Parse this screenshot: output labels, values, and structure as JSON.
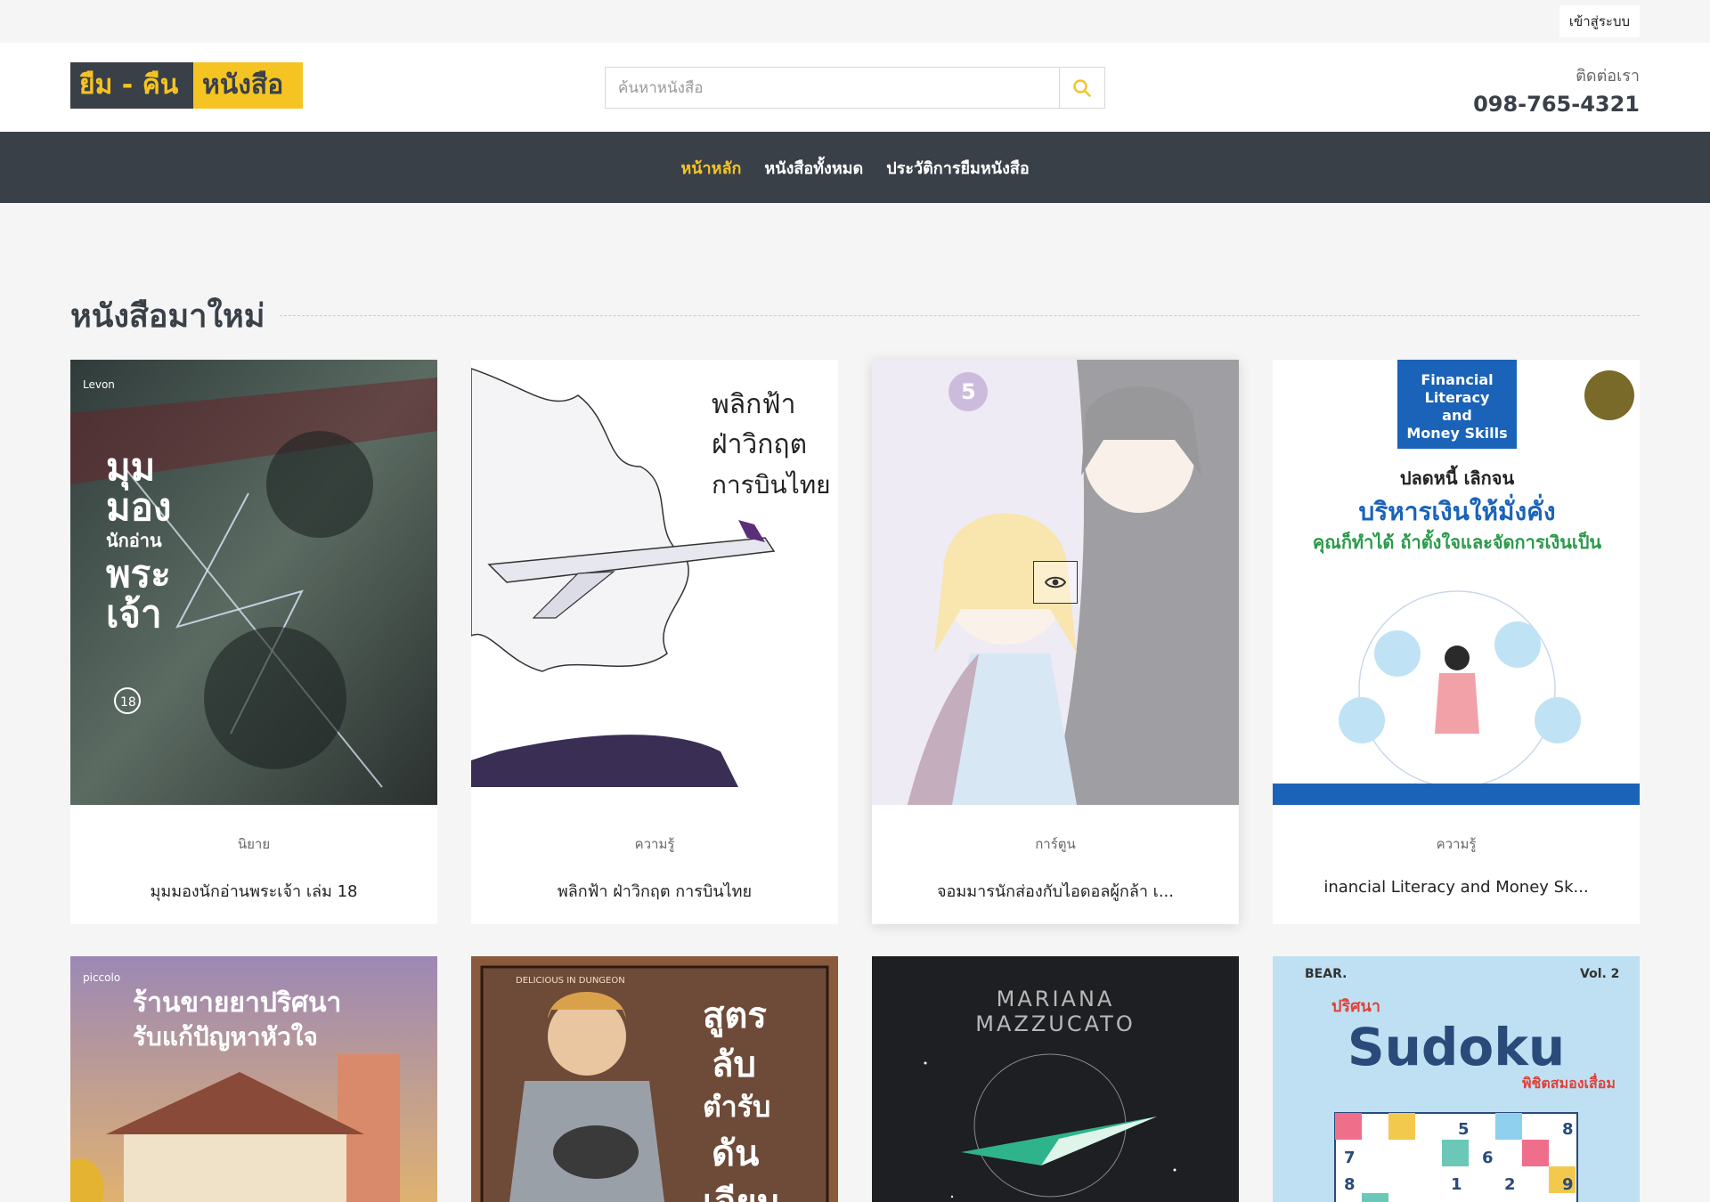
{
  "topbar": {
    "login_label": "เข้าสู่ระบบ"
  },
  "header": {
    "logo_left": "ยืม - คืน",
    "logo_right": "หนังสือ",
    "search_placeholder": "ค้นหาหนังสือ",
    "contact_label": "ติดต่อเรา",
    "contact_phone": "098-765-4321"
  },
  "nav": {
    "items": [
      {
        "label": "หน้าหลัก",
        "active": true
      },
      {
        "label": "หนังสือทั้งหมด",
        "active": false
      },
      {
        "label": "ประวัติการยืมหนังสือ",
        "active": false
      }
    ]
  },
  "section": {
    "title": "หนังสือมาใหม่"
  },
  "books": [
    {
      "category": "นิยาย",
      "title": "มุมมองนักอ่านพระเจ้า เล่ม 18",
      "cover_text": "มุมมองนักอ่านพระเจ้า",
      "cover_badge": "Levon",
      "cover_color": "#3c4a44"
    },
    {
      "category": "ความรู้",
      "title": "พลิกฟ้า ฝ่าวิกฤต การบินไทย",
      "cover_text": "พลิกฟ้า ฝ่าวิกฤต การบินไทย",
      "cover_color": "#ffffff"
    },
    {
      "category": "การ์ตูน",
      "title": "จอมมารนักส่องกับไอดอลผู้กล้า เ...",
      "cover_text": "5",
      "cover_color": "#d9d2e8"
    },
    {
      "category": "ความรู้",
      "title": "inancial Literacy and Money Sk...",
      "cover_text": "Financial Literacy and Money Skills",
      "cover_color": "#ffffff"
    },
    {
      "cover_text": "ร้านขายยาปริศนา รับแก้ปัญหาหัวใจ",
      "cover_badge": "piccolo",
      "cover_color": "#a58ea6"
    },
    {
      "cover_text": "สูตรลับตำรับดันเจียน",
      "cover_badge": "DELICIOUS IN DUNGEON",
      "cover_color": "#8a5a3c"
    },
    {
      "cover_text": "MARIANA MAZZUCATO",
      "cover_color": "#1d1f22"
    },
    {
      "cover_text": "Sudoku",
      "cover_badge": "BEAR.",
      "cover_extra": "Vol. 2",
      "cover_subtitle": "ปริศนา",
      "cover_tagline": "พิชิตสมองเสื่อม",
      "cover_color": "#bfe0f2"
    }
  ]
}
